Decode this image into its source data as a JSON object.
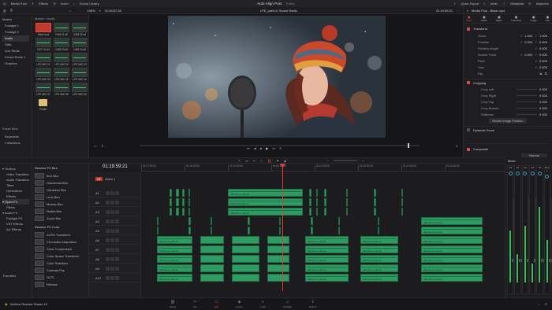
{
  "topbar": {
    "media_pool": "Media Pool",
    "effects": "Effects",
    "index": "Index",
    "sound_library": "Sound Library",
    "timeline_name": "Auto-Align Post",
    "edited": "Edited",
    "quick_export": "Quick Export",
    "mixer": "Mixer",
    "metadata": "Metadata",
    "inspector": "Inspector"
  },
  "viewer_bar": {
    "zoom": "106%",
    "timecode": "01:26:57:28",
    "clip_name": "LPE_parts in Sound Radio",
    "timecode_right": "01:19:59:21"
  },
  "media_pool": {
    "breadcrumb": "Master / Audio",
    "bins": [
      "Master",
      "Footage 1",
      "Footage 2",
      "Audio",
      "Stills",
      "Live Shots",
      "Crowd Shots 1",
      "Graphics"
    ],
    "clips": [
      {
        "label": "Black mp4",
        "kind": "video"
      },
      {
        "label": "CAM 01 aif",
        "kind": "audio"
      },
      {
        "label": "CAM 02 aif",
        "kind": "audio"
      },
      {
        "label": "DKY 01 aif",
        "kind": "audio"
      },
      {
        "label": "CAM 03 aif",
        "kind": "audio"
      },
      {
        "label": "CAM 04 aif",
        "kind": "audio"
      },
      {
        "label": "LPE MIC 01",
        "kind": "audio"
      },
      {
        "label": "LPE MIC 02",
        "kind": "audio"
      },
      {
        "label": "LPE MIC 03",
        "kind": "audio"
      },
      {
        "label": "LPE MIC 04",
        "kind": "audio"
      },
      {
        "label": "LPE MIC 05",
        "kind": "audio"
      },
      {
        "label": "LPE MIC 06",
        "kind": "audio"
      },
      {
        "label": "LPE MIC 07",
        "kind": "audio"
      },
      {
        "label": "LPE MIC 08",
        "kind": "audio"
      },
      {
        "label": "LPE MIC 09",
        "kind": "audio"
      },
      {
        "label": "Folder",
        "kind": "folder"
      }
    ],
    "smart_bins_title": "Smart Bins",
    "smart_bins": [
      "Keywords",
      "Collections"
    ]
  },
  "effects_panel": {
    "tree": [
      "Toolbox",
      "Video Transitions",
      "Audio Transitions",
      "Titles",
      "Generators",
      "Effects",
      "Open FX",
      "Filters",
      "Audio FX",
      "Fairlight FX",
      "VST Effects",
      "AU Effects"
    ],
    "favorites": "Favorites",
    "group1_title": "Resolve FX Blur",
    "group1": [
      "Box Blur",
      "Directional Blur",
      "Gaussian Blur",
      "Lens Blur",
      "Mosaic Blur",
      "Radial Blur",
      "Zoom Blur"
    ],
    "group2_title": "Resolve FX Color",
    "group2": [
      "ACES Transform",
      "Chromatic Adaptation",
      "Color Compressor",
      "Color Space Transform",
      "Color Stabilizer",
      "Contrast Pop",
      "DCTL",
      "Dehaze"
    ]
  },
  "timeline": {
    "timecode": "01:19:59:21",
    "ruler": [
      "01:17:00:00",
      "01:18:00:00",
      "01:19:00:00",
      "01:20:00:00",
      "01:21:00:00",
      "01:22:00:00",
      "01:23:00:00",
      "01:24:00:00"
    ],
    "video_track": "V1",
    "video_track_label": "Video 1",
    "audio_tracks": [
      "A1",
      "A2",
      "A3",
      "A4",
      "A5",
      "A6",
      "A7",
      "A8",
      "A9",
      "A10"
    ],
    "clip_label": "LPE CH 1-2_03.mov"
  },
  "inspector": {
    "title": "Media Pool - Black mp4",
    "tabs": [
      "Video",
      "Audio",
      "Effect",
      "Transition",
      "Image",
      "File"
    ],
    "transform_title": "Transform",
    "transform": [
      {
        "label": "Zoom",
        "x": "1.000",
        "y": "1.000"
      },
      {
        "label": "Position",
        "x": "0.000",
        "y": "0.000"
      },
      {
        "label": "Rotation Angle",
        "x": "0.000",
        "y": ""
      },
      {
        "label": "Anchor Point",
        "x": "0.000",
        "y": "0.000"
      },
      {
        "label": "Pitch",
        "x": "0.000",
        "y": ""
      },
      {
        "label": "Yaw",
        "x": "0.000",
        "y": ""
      },
      {
        "label": "Flip",
        "x": "",
        "y": ""
      }
    ],
    "cropping_title": "Cropping",
    "cropping": [
      {
        "label": "Crop Left",
        "value": "0.000"
      },
      {
        "label": "Crop Right",
        "value": "0.000"
      },
      {
        "label": "Crop Top",
        "value": "0.000"
      },
      {
        "label": "Crop Bottom",
        "value": "0.000"
      },
      {
        "label": "Softness",
        "value": "0.000"
      }
    ],
    "retain": "Retain Image Position",
    "dynamic_zoom_title": "Dynamic Zoom",
    "composite_title": "Composite",
    "composite_mode": "Normal"
  },
  "mixer": {
    "title": "Mixer",
    "channels": [
      "A1",
      "A2",
      "A3",
      "A4",
      "A5",
      "Bus 1"
    ],
    "levels": [
      0.55,
      0.3,
      0.6,
      0.2,
      0.8,
      0.45
    ]
  },
  "pages": {
    "app_name": "DaVinci Resolve Studio 19",
    "items": [
      "Media",
      "Cut",
      "Edit",
      "Fusion",
      "Color",
      "Fairlight",
      "Deliver"
    ],
    "active": "Edit"
  },
  "colors": {
    "audio_clip": "#2e9b63",
    "playhead": "#e33b3b",
    "accent": "#e04b4b"
  }
}
